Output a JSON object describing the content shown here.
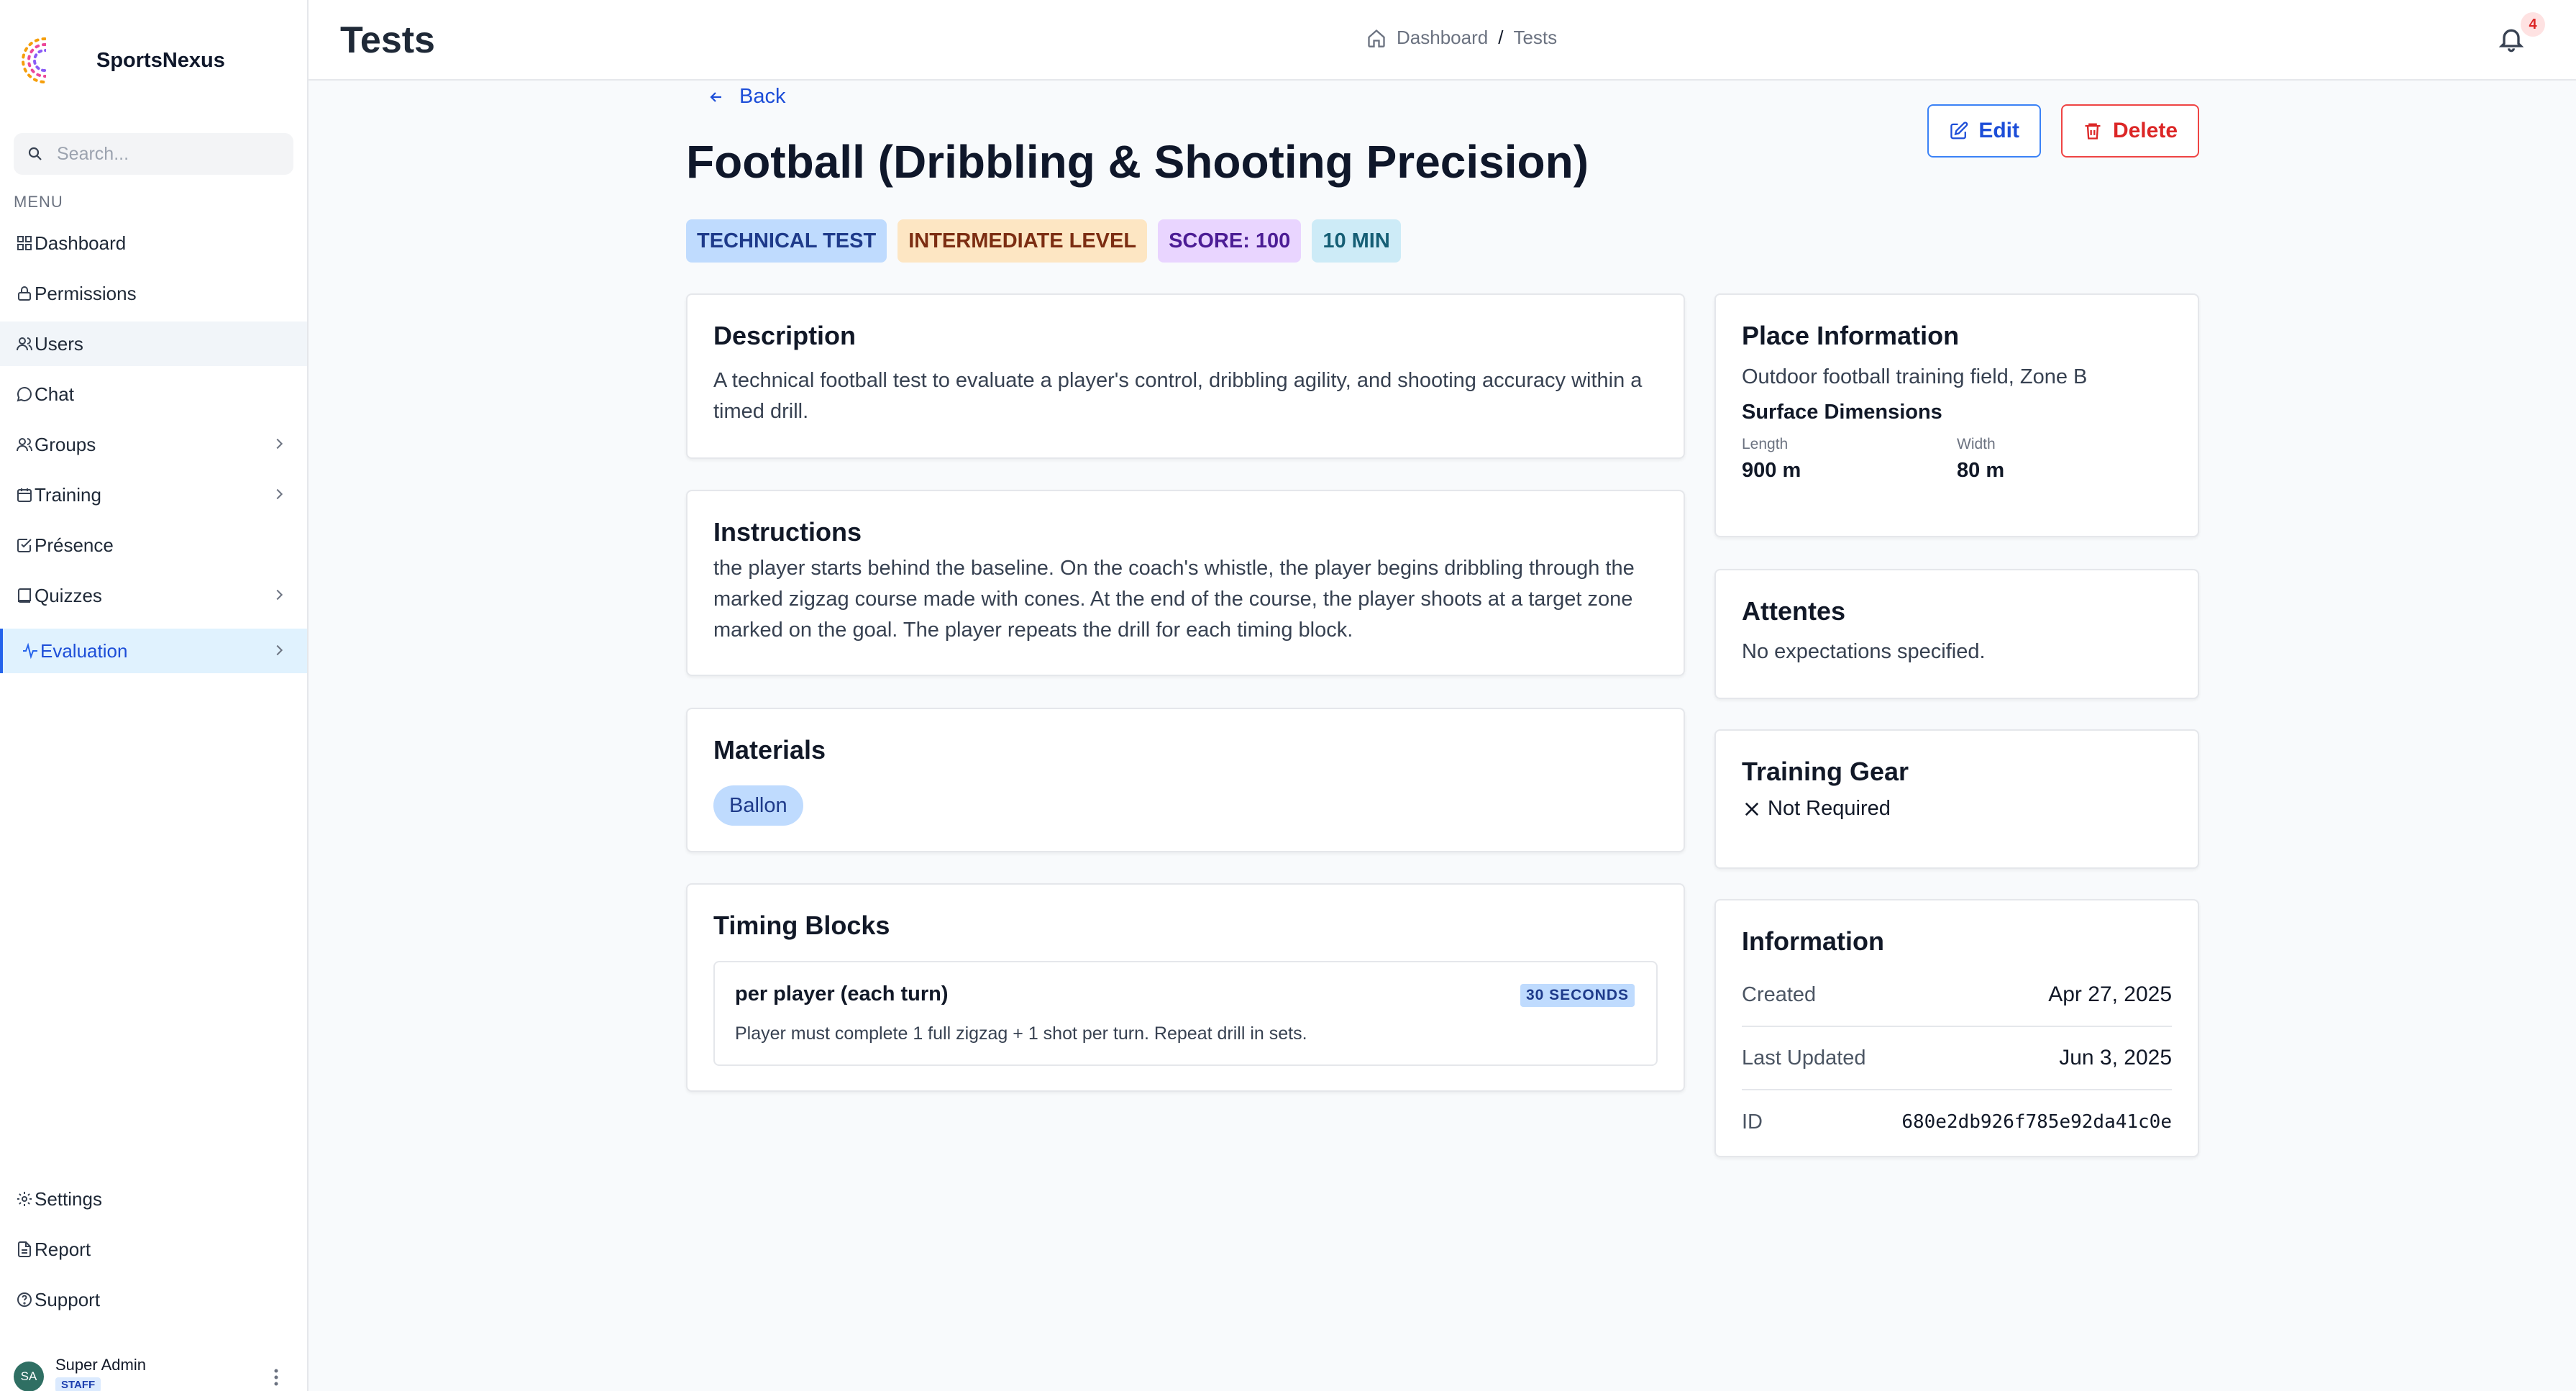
{
  "brand": {
    "name": "SportsNexus"
  },
  "search": {
    "placeholder": "Search..."
  },
  "menu_label": "MENU",
  "nav": {
    "dashboard": "Dashboard",
    "permissions": "Permissions",
    "users": "Users",
    "chat": "Chat",
    "groups": "Groups",
    "training": "Training",
    "presence": "Présence",
    "quizzes": "Quizzes",
    "evaluation": "Evaluation",
    "settings": "Settings",
    "report": "Report",
    "support": "Support"
  },
  "user": {
    "initials": "SA",
    "name": "Super Admin",
    "role": "STAFF"
  },
  "header": {
    "title": "Tests",
    "breadcrumb": [
      "Dashboard",
      "Tests"
    ],
    "breadcrumb_sep": "/",
    "notifications": "4"
  },
  "test": {
    "back_label": "Back",
    "title": "Football (Dribbling & Shooting Precision)",
    "edit_label": "Edit",
    "delete_label": "Delete",
    "tags": {
      "type": "TECHNICAL TEST",
      "level": "INTERMEDIATE LEVEL",
      "score": "SCORE: 100",
      "duration": "10 MIN"
    },
    "description": {
      "heading": "Description",
      "text": "A technical football test to evaluate a player's control, dribbling agility, and shooting accuracy within a timed drill."
    },
    "instructions": {
      "heading": "Instructions",
      "text": "the player starts behind the baseline. On the coach's whistle, the player begins dribbling through the marked zigzag course made with cones. At the end of the course, the player shoots at a target zone marked on the goal. The player repeats the drill for each timing block."
    },
    "materials": {
      "heading": "Materials",
      "items": [
        "Ballon"
      ]
    },
    "timing": {
      "heading": "Timing Blocks",
      "blocks": [
        {
          "title": "per player (each turn)",
          "badge": "30 SECONDS",
          "note": "Player must complete 1 full zigzag + 1 shot per turn. Repeat drill in sets."
        }
      ]
    },
    "place": {
      "heading": "Place Information",
      "location": "Outdoor football training field, Zone B",
      "dimensions_heading": "Surface Dimensions",
      "length_label": "Length",
      "length_value": "900 m",
      "width_label": "Width",
      "width_value": "80 m"
    },
    "attentes": {
      "heading": "Attentes",
      "text": "No expectations specified."
    },
    "gear": {
      "heading": "Training Gear",
      "status": "Not Required"
    },
    "info": {
      "heading": "Information",
      "created_label": "Created",
      "created_value": "Apr 27, 2025",
      "updated_label": "Last Updated",
      "updated_value": "Jun 3, 2025",
      "id_label": "ID",
      "id_value": "680e2db926f785e92da41c0e"
    }
  },
  "colors": {
    "accent": "#2563eb",
    "danger": "#dc2626",
    "tag_blue": "#bfdbfe",
    "tag_orange": "#fde6c3",
    "tag_purple": "#e9d5ff",
    "tag_cyan": "#cdebf7"
  }
}
